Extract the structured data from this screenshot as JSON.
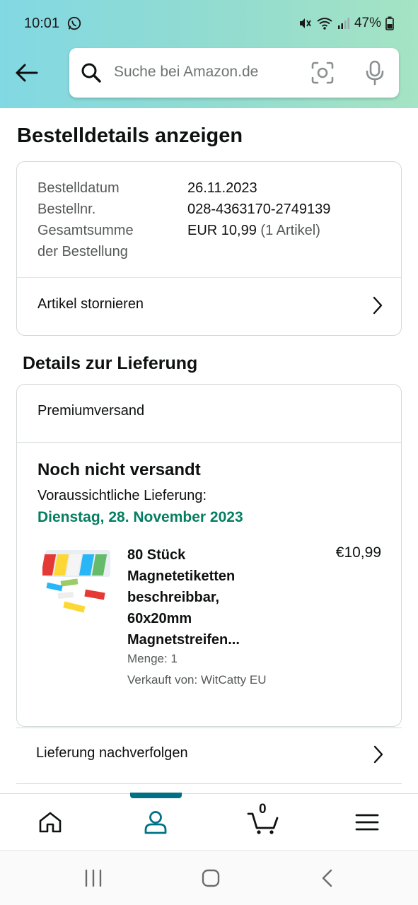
{
  "status_bar": {
    "time": "10:01",
    "battery": "47%"
  },
  "search": {
    "placeholder": "Suche bei Amazon.de"
  },
  "page": {
    "title": "Bestelldetails anzeigen"
  },
  "order": {
    "date_label": "Bestelldatum",
    "date_value": "26.11.2023",
    "number_label": "Bestellnr.",
    "number_value": "028-4363170-2749139",
    "total_label_line1": "Gesamtsumme",
    "total_label_line2": "der Bestellung",
    "total_value": "EUR 10,99",
    "total_items": "(1 Artikel)",
    "cancel_label": "Artikel stornieren"
  },
  "delivery": {
    "section_title": "Details zur Lieferung",
    "shipping_method": "Premiumversand",
    "status": "Noch nicht versandt",
    "expected_label": "Voraussichtliche Lieferung:",
    "expected_date": "Dienstag, 28. November 2023",
    "product": {
      "name_lines": [
        "80 Stück",
        "Magnetetiketten",
        "beschreibbar,",
        "60x20mm",
        "Magnetstreifen..."
      ],
      "price": "€10,99",
      "quantity": "Menge: 1",
      "seller": "Verkauft von: WitCatty EU"
    },
    "track_label": "Lieferung nachverfolgen"
  },
  "bottom_nav": {
    "active": "account",
    "cart_count": "0",
    "accent_color": "#007185"
  },
  "colors": {
    "header_gradient_start": "#82d8e3",
    "header_gradient_end": "#a5e4c4",
    "delivery_date_green": "#067d62"
  }
}
